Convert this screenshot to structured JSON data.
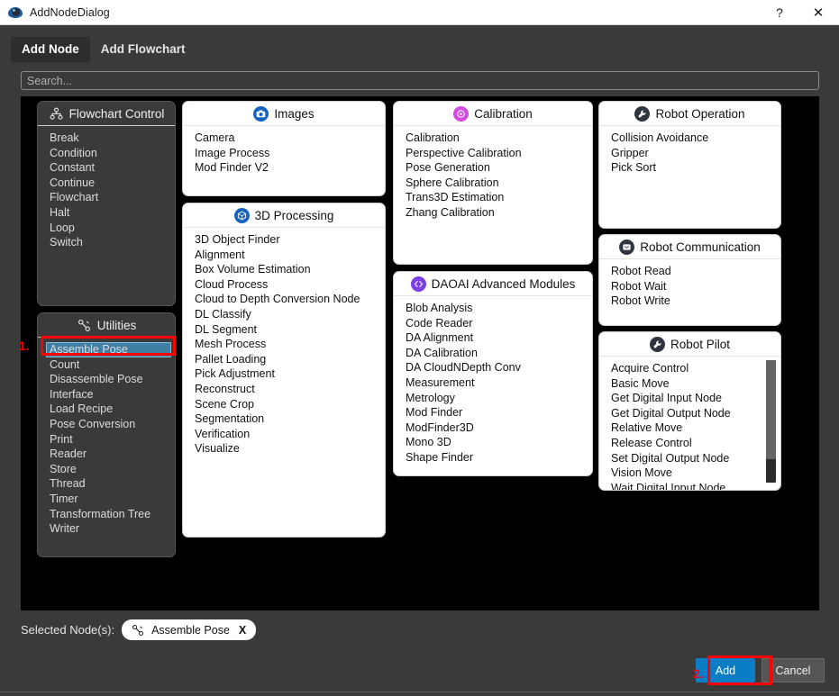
{
  "window": {
    "title": "AddNodeDialog",
    "app_icon": "eye-logo-icon",
    "help_label": "?",
    "close_label": "✕"
  },
  "tabs": [
    {
      "label": "Add Node",
      "active": true
    },
    {
      "label": "Add Flowchart",
      "active": false
    }
  ],
  "search": {
    "value": "",
    "placeholder": "Search..."
  },
  "categories": [
    {
      "title": "Flowchart Control",
      "icon": "org-chart-icon",
      "theme": "dark",
      "items": [
        "Break",
        "Condition",
        "Constant",
        "Continue",
        "Flowchart",
        "Halt",
        "Loop",
        "Switch"
      ]
    },
    {
      "title": "Utilities",
      "icon": "wrench-icon",
      "theme": "dark",
      "items": [
        "Assemble Pose",
        "Count",
        "Disassemble Pose",
        "Interface",
        "Load Recipe",
        "Pose Conversion",
        "Print",
        "Reader",
        "Store",
        "Thread",
        "Timer",
        "Transformation Tree",
        "Writer"
      ],
      "selected_item": "Assemble Pose"
    },
    {
      "title": "Images",
      "icon": "camera-icon",
      "theme": "light",
      "items": [
        "Camera",
        "Image Process",
        "Mod Finder V2"
      ]
    },
    {
      "title": "3D Processing",
      "icon": "cube-icon",
      "theme": "light",
      "items": [
        "3D Object Finder",
        "Alignment",
        "Box Volume Estimation",
        "Cloud Process",
        "Cloud to Depth Conversion Node",
        "DL Classify",
        "DL Segment",
        "Mesh Process",
        "Pallet Loading",
        "Pick Adjustment",
        "Reconstruct",
        "Scene Crop",
        "Segmentation",
        "Verification",
        "Visualize"
      ]
    },
    {
      "title": "Calibration",
      "icon": "target-icon",
      "theme": "light",
      "items": [
        "Calibration",
        "Perspective Calibration",
        "Pose Generation",
        "Sphere Calibration",
        "Trans3D Estimation",
        "Zhang Calibration"
      ]
    },
    {
      "title": "DAOAI Advanced Modules",
      "icon": "code-brackets-icon",
      "theme": "light",
      "items": [
        "Blob Analysis",
        "Code Reader",
        "DA Alignment",
        "DA Calibration",
        "DA CloudNDepth Conv",
        "Measurement",
        "Metrology",
        "Mod Finder",
        "ModFinder3D",
        "Mono 3D",
        "Shape Finder"
      ]
    },
    {
      "title": "Robot Operation",
      "icon": "wrench-circle-icon",
      "theme": "light",
      "items": [
        "Collision Avoidance",
        "Gripper",
        "Pick Sort"
      ]
    },
    {
      "title": "Robot Communication",
      "icon": "message-icon",
      "theme": "light",
      "items": [
        "Robot Read",
        "Robot Wait",
        "Robot Write"
      ]
    },
    {
      "title": "Robot Pilot",
      "icon": "wrench-circle-icon",
      "theme": "light",
      "scrollable": true,
      "items": [
        "Acquire Control",
        "Basic Move",
        "Get Digital Input Node",
        "Get Digital Output Node",
        "Relative Move",
        "Release Control",
        "Set Digital Output Node",
        "Vision Move",
        "Wait Digital Input Node"
      ]
    }
  ],
  "selected_nodes": {
    "label": "Selected Node(s):",
    "chips": [
      {
        "icon": "wrench-icon",
        "label": "Assemble Pose",
        "remove_label": "X"
      }
    ]
  },
  "footer": {
    "add_label": "Add",
    "cancel_label": "Cancel"
  },
  "annotations": [
    {
      "number": "1.",
      "target": "assemble-pose-item"
    },
    {
      "number": "2.",
      "target": "add-button"
    }
  ],
  "colors": {
    "accent_blue": "#0a7dc4",
    "selection_blue": "#3f7fa6",
    "annotation_red": "#ff0000",
    "panel_dark": "#3a3a3a",
    "content_black": "#000000"
  }
}
